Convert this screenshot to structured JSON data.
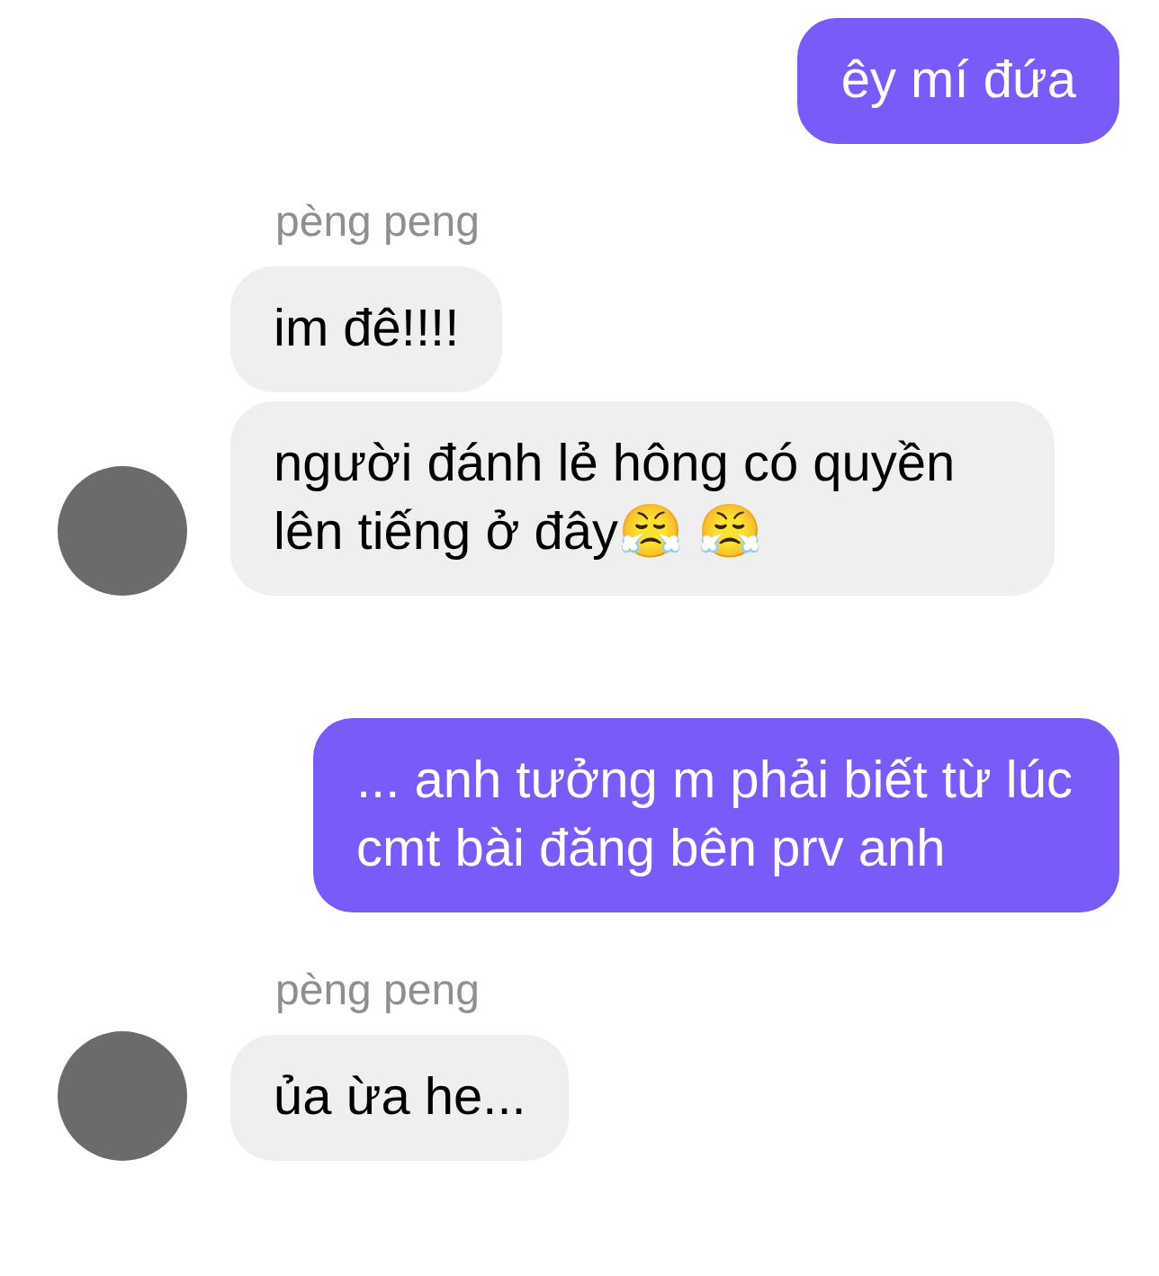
{
  "messages": [
    {
      "kind": "outgoing",
      "bubbles": [
        {
          "text": "êy mí đứa"
        }
      ]
    },
    {
      "kind": "incoming",
      "sender": "pèng peng",
      "bubbles": [
        {
          "text": "im đê!!!!"
        },
        {
          "text": "người đánh lẻ hông có quyền lên tiếng ở đây😤 😤"
        }
      ]
    },
    {
      "kind": "outgoing",
      "bubbles": [
        {
          "text": "... anh tưởng m phải biết từ lúc cmt bài đăng bên prv anh"
        }
      ]
    },
    {
      "kind": "incoming",
      "sender": "pèng peng",
      "bubbles": [
        {
          "text": "ủa ừa he..."
        }
      ]
    }
  ]
}
